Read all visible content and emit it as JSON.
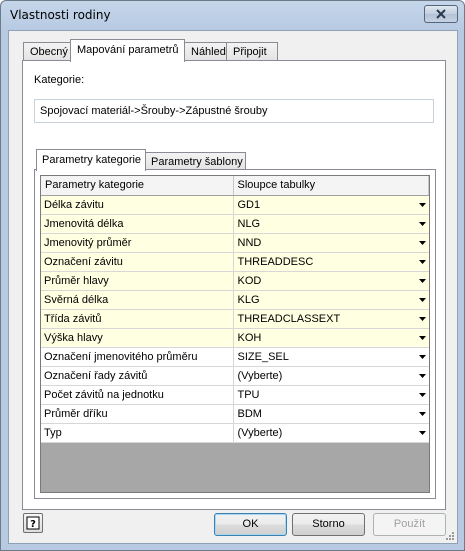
{
  "window": {
    "title": "Vlastnosti rodiny"
  },
  "tabs": [
    {
      "label": "Obecný",
      "active": false
    },
    {
      "label": "Mapování parametrů",
      "active": true
    },
    {
      "label": "Náhled",
      "active": false
    },
    {
      "label": "Připojit",
      "active": false
    }
  ],
  "category": {
    "label": "Kategorie:",
    "value": "Spojovací materiál->Šrouby->Zápustné šrouby"
  },
  "inner_tabs": [
    {
      "label": "Parametry kategorie",
      "active": true
    },
    {
      "label": "Parametry šablony",
      "active": false
    }
  ],
  "grid": {
    "headers": [
      "Parametry kategorie",
      "Sloupce tabulky"
    ],
    "rows": [
      {
        "param": "Délka závitu",
        "column": "GD1",
        "highlighted": true
      },
      {
        "param": "Jmenovitá délka",
        "column": "NLG",
        "highlighted": true
      },
      {
        "param": "Jmenovitý průměr",
        "column": "NND",
        "highlighted": true
      },
      {
        "param": "Označení závitu",
        "column": "THREADDESC",
        "highlighted": true
      },
      {
        "param": "Průměr hlavy",
        "column": "KOD",
        "highlighted": true
      },
      {
        "param": "Svěrná délka",
        "column": "KLG",
        "highlighted": true
      },
      {
        "param": "Třída závitů",
        "column": "THREADCLASSEXT",
        "highlighted": true
      },
      {
        "param": "Výška hlavy",
        "column": "KOH",
        "highlighted": true
      },
      {
        "param": "Označení jmenovitého průměru",
        "column": "SIZE_SEL",
        "highlighted": false
      },
      {
        "param": "Označení řady závitů",
        "column": "(Vyberte)",
        "highlighted": false
      },
      {
        "param": "Počet závitů na jednotku",
        "column": "TPU",
        "highlighted": false
      },
      {
        "param": "Průměr dříku",
        "column": "BDM",
        "highlighted": false
      },
      {
        "param": "Typ",
        "column": "(Vyberte)",
        "highlighted": false
      }
    ]
  },
  "buttons": {
    "help": "?",
    "ok": "OK",
    "cancel": "Storno",
    "apply": "Použít"
  },
  "icons": {
    "close": "close-icon",
    "help": "help-icon",
    "dropdown": "chevron-down-icon"
  },
  "colors": {
    "highlight_row": "#ffffe1",
    "grid_empty": "#a7a7a7"
  }
}
